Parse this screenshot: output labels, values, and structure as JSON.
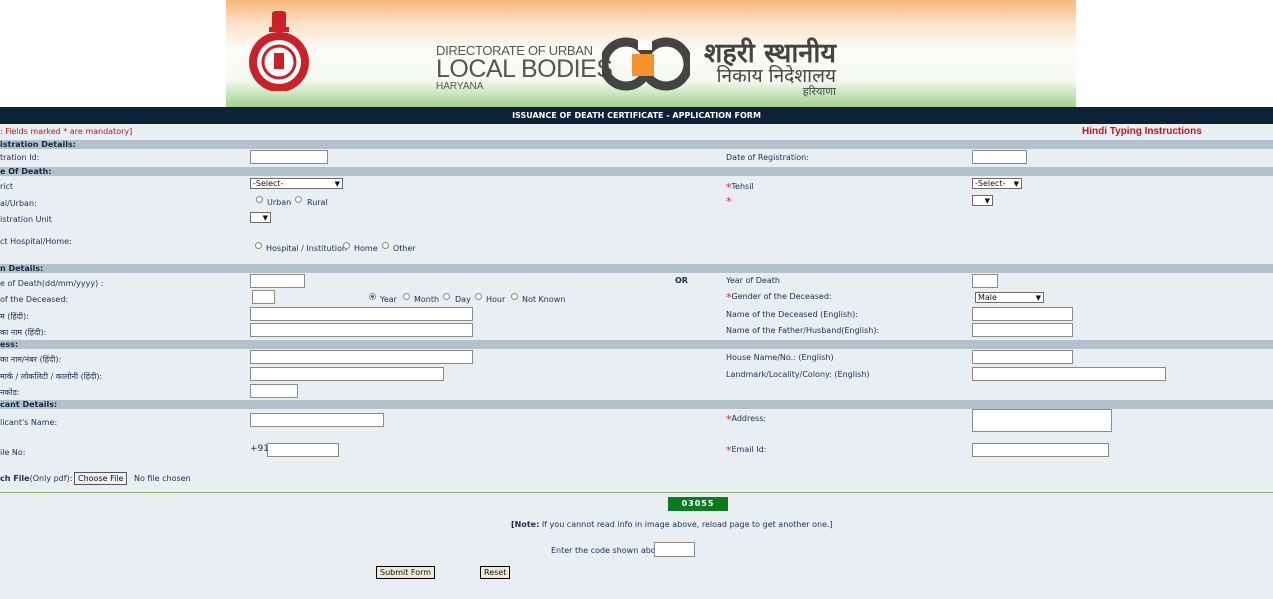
{
  "banner": {
    "en_line1": "DIRECTORATE OF URBAN",
    "en_line2": "LOCAL BODIES",
    "en_line3": "HARYANA",
    "hi_line1": "शहरी स्थानीय",
    "hi_line2": "निकाय निदेशालय",
    "hi_line3": "हरियाणा"
  },
  "form_title": "ISSUANCE OF DEATH CERTIFICATE  - APPLICATION FORM",
  "mandatory_note": ": Fields marked * are mandatory]",
  "hindi_typing": "Hindi Typing Instructions",
  "sections": {
    "registration": "istration  Details:",
    "place": "e Of Death:",
    "death": "n Details:",
    "address": "ess:",
    "applicant": "cant Details:"
  },
  "registration": {
    "reg_id_label": "tration Id:",
    "date_label": "Date of Registration:"
  },
  "place": {
    "district_label": "rict",
    "district_value": "-Select-",
    "tehsil_label": "Tehsil",
    "tehsil_value": "-Select-",
    "area_label": "al/Urban:",
    "urban": "Urban",
    "rural": "Rural",
    "unit_label": "istration Unit",
    "hospital_label": "ct Hospital/Home:",
    "hospital": "Hospital / Institution",
    "home": "Home",
    "other": "Other"
  },
  "death": {
    "date_label": "e of Death(dd/mm/yyyy) :",
    "or": "OR",
    "year_label": "Year of Death",
    "age_label": " of the Deceased:",
    "year": "Year",
    "month": "Month",
    "day": "Day",
    "hour": "Hour",
    "not_known": "Not Known",
    "gender_label": "Gender of the Deceased:",
    "gender_value": "Male",
    "name_hi_label": "म (हिंदी):",
    "name_en_label": "Name of the Deceased (English):",
    "father_hi_label": " का नाम (हिंदी):",
    "father_en_label": "Name of the Father/Husband(English):"
  },
  "address": {
    "house_hi_label": " का नाम/नंबर (हिंदी):",
    "house_en_label": "House Name/No.: (English)",
    "landmark_hi_label": "मार्क / लोकलिटी / कालोनी (हिंदी):",
    "landmark_en_label": "Landmark/Locality/Colony: (English)",
    "pin_label": "नकोड:"
  },
  "applicant": {
    "name_label": "licant's Name:",
    "address_label": "Address:",
    "mobile_label": "ile No:",
    "mobile_prefix": "+91",
    "email_label": "Email Id:",
    "attach_label": "ch File",
    "attach_hint": "(Only pdf):",
    "choose_file": "Choose File",
    "no_file": "No file chosen"
  },
  "captcha": {
    "code": "03055",
    "note_bold": "[Note:",
    "note_text": " If you cannot read info in image above, reload page to get another one.]",
    "enter_label": "Enter the code shown above:"
  },
  "buttons": {
    "submit": "Submit Form",
    "reset": "Reset"
  },
  "colors": {
    "title_bar": "#0d2137",
    "section_bar": "#b4c1cd",
    "form_bg": "#e9eef3",
    "mandatory": "#c0151d",
    "captcha_bg": "#0a7b1f"
  }
}
